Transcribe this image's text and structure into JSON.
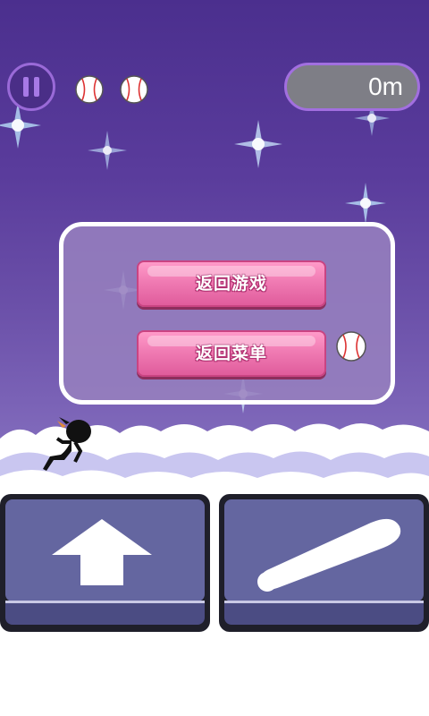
{
  "hud": {
    "pause_icon": "pause-icon",
    "lives_icon": "baseball-icon",
    "lives": 2,
    "distance": "0m"
  },
  "pause_menu": {
    "resume_label": "返回游戏",
    "menu_label": "返回菜单",
    "badge_icon": "baseball-icon"
  },
  "controls": {
    "jump_icon": "arrow-up-icon",
    "swing_icon": "baseball-bat-icon"
  },
  "colors": {
    "sky_top": "#4b2f8e",
    "sky_bottom": "#8c78c4",
    "button_pink": "#f07bb3",
    "control_face": "#6466a0"
  }
}
